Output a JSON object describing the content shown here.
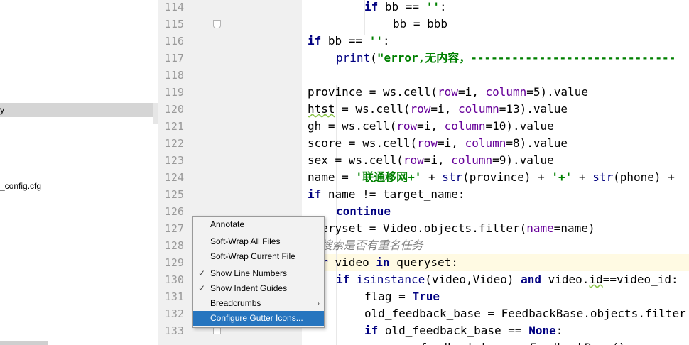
{
  "tree": {
    "selected_item": "y",
    "file_item": "_config.cfg"
  },
  "gutter": {
    "line_numbers": [
      "114",
      "115",
      "116",
      "117",
      "118",
      "119",
      "120",
      "121",
      "122",
      "123",
      "124",
      "125",
      "126",
      "127",
      "128",
      "129",
      "130",
      "131",
      "132",
      "133"
    ],
    "current_line": "129"
  },
  "editor": {
    "current_line": "129"
  },
  "context_menu": {
    "items": [
      {
        "label": "Annotate"
      },
      {
        "label": "Soft-Wrap All Files"
      },
      {
        "label": "Soft-Wrap Current File"
      },
      {
        "label": "Show Line Numbers",
        "checked": true
      },
      {
        "label": "Show Indent Guides",
        "checked": true
      },
      {
        "label": "Breadcrumbs",
        "submenu": true
      },
      {
        "label": "Configure Gutter Icons...",
        "highlighted": true
      }
    ],
    "check_glyph": "✓",
    "submenu_glyph": "›"
  },
  "colors": {
    "keyword": "#000080",
    "string": "#008000",
    "param": "#660099",
    "comment": "#808080",
    "gutter_bg": "#f0f0f0",
    "menu_highlight": "#2675bf",
    "current_line_bg": "#fffae3"
  },
  "icons": {
    "check": "check-icon",
    "submenu": "chevron-right-icon",
    "fold": "fold-marker-icon"
  }
}
